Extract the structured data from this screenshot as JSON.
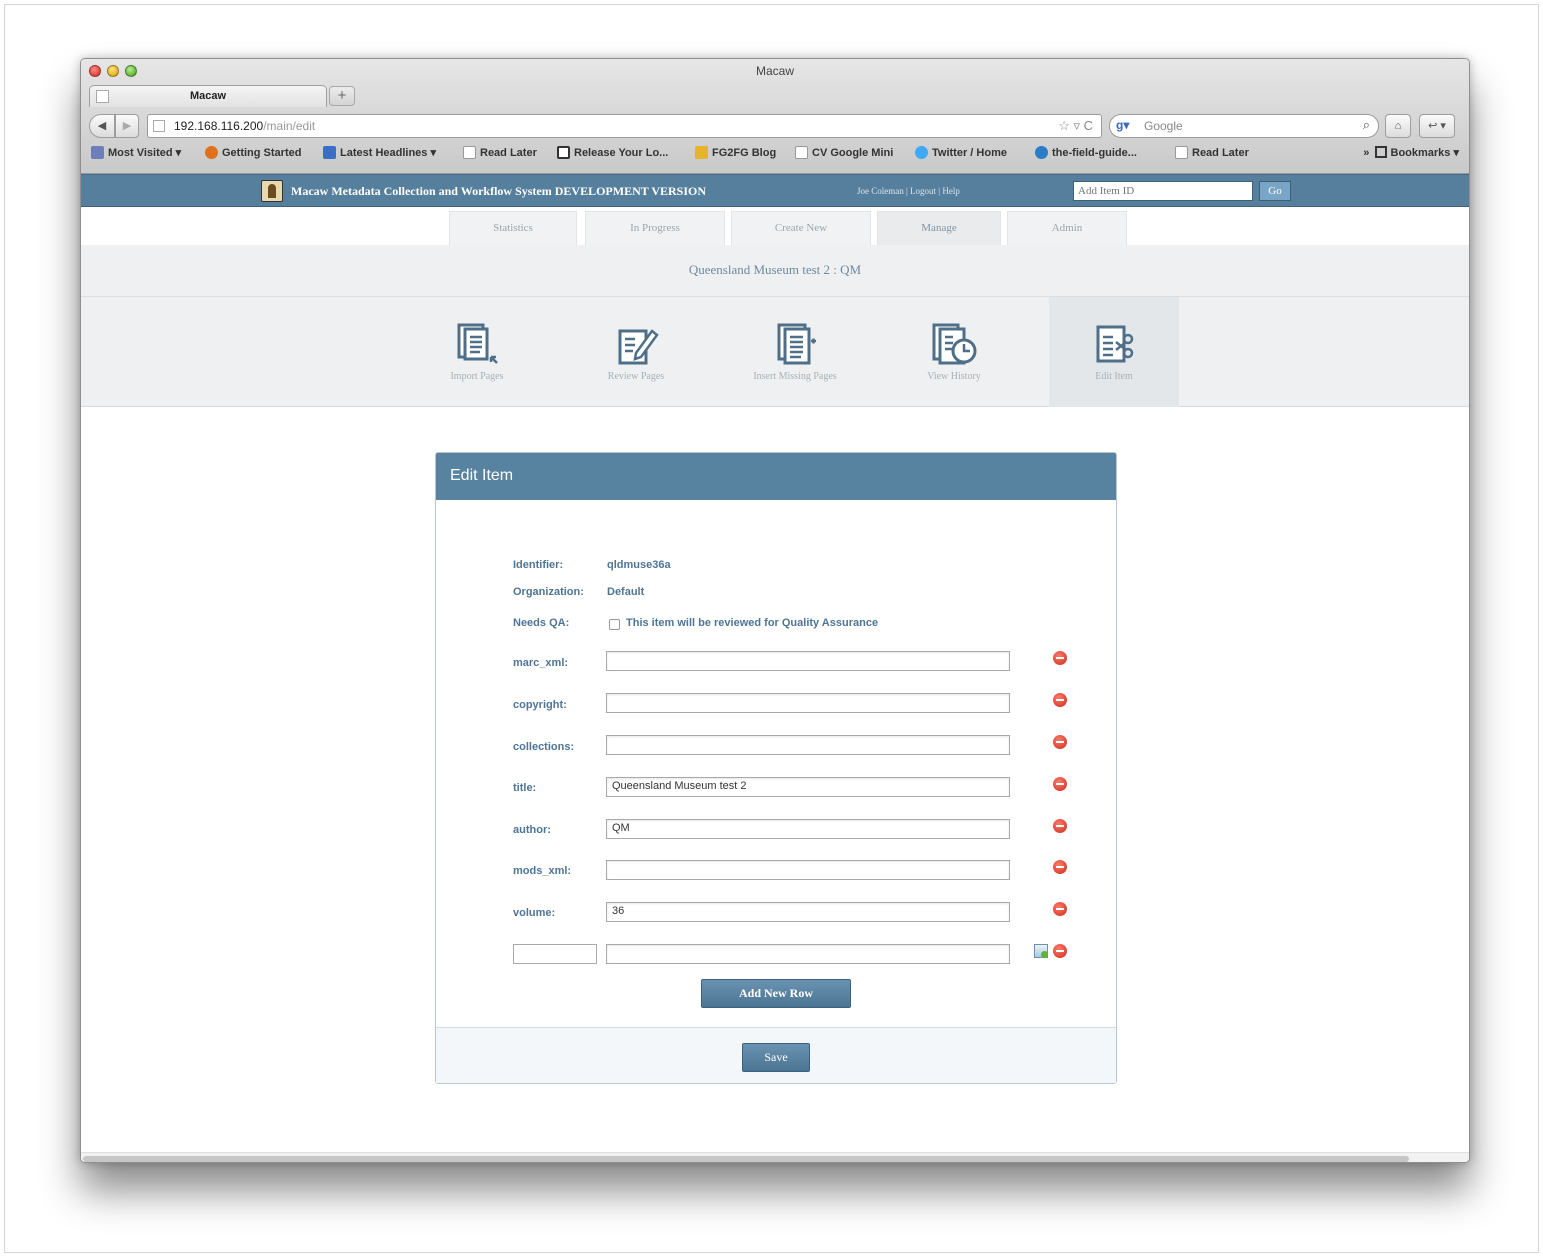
{
  "browser": {
    "window_title": "Macaw",
    "tab_label": "Macaw",
    "new_tab": "+",
    "back": "◀",
    "forward": "▶",
    "url_host": "192.168.116.200",
    "url_path": "/main/edit",
    "url_icons": "☆ ▿ C",
    "search_engine": "g▾",
    "search_placeholder": "Google",
    "search_icon": "⌕",
    "home_icon": "⌂",
    "tools_icon": "↩ ▾",
    "bookmarks": [
      {
        "label": "Most Visited ▾",
        "color": "#6c7fb8"
      },
      {
        "label": "Getting Started",
        "color": "#e0711c"
      },
      {
        "label": "Latest Headlines ▾",
        "color": "#3a6fc8"
      },
      {
        "label": "Read Later",
        "color": "#ffffff"
      },
      {
        "label": "Release Your Lo...",
        "color": "#ffffff"
      },
      {
        "label": "FG2FG Blog",
        "color": "#e6b32b"
      },
      {
        "label": "CV Google Mini",
        "color": "#ffffff"
      },
      {
        "label": "Twitter / Home",
        "color": "#3fa9f5"
      },
      {
        "label": "the-field-guide...",
        "color": "#2b7cc7"
      },
      {
        "label": "Read Later",
        "color": "#ffffff"
      }
    ],
    "bookmarks_overflow": "»",
    "bookmarks_menu": "Bookmarks ▾"
  },
  "app": {
    "title": "Macaw Metadata Collection and Workflow System DEVELOPMENT VERSION",
    "user_links": "Joe Coleman | Logout | Help",
    "item_id_placeholder": "Add Item ID",
    "go_label": "Go"
  },
  "main_tabs": [
    {
      "label": "Statistics",
      "active": false
    },
    {
      "label": "In Progress",
      "active": false
    },
    {
      "label": "Create New",
      "active": false
    },
    {
      "label": "Manage",
      "active": true
    },
    {
      "label": "Admin",
      "active": false
    }
  ],
  "item_title": "Queensland Museum test 2 : QM",
  "tools": [
    {
      "label": "Import Pages",
      "icon": "import-pages-icon",
      "active": false
    },
    {
      "label": "Review Pages",
      "icon": "review-pages-icon",
      "active": false
    },
    {
      "label": "Insert Missing Pages",
      "icon": "insert-missing-pages-icon",
      "active": false
    },
    {
      "label": "View History",
      "icon": "view-history-icon",
      "active": false
    },
    {
      "label": "Edit Item",
      "icon": "edit-item-icon",
      "active": true
    }
  ],
  "panel": {
    "title": "Edit Item",
    "identifier_label": "Identifier:",
    "identifier_value": "qldmuse36a",
    "organization_label": "Organization:",
    "organization_value": "Default",
    "needs_qa_label": "Needs QA:",
    "needs_qa_text": "This item will be reviewed for Quality Assurance",
    "needs_qa_checked": false,
    "fields": [
      {
        "label": "marc_xml:",
        "value": ""
      },
      {
        "label": "copyright:",
        "value": ""
      },
      {
        "label": "collections:",
        "value": ""
      },
      {
        "label": "title:",
        "value": "Queensland Museum test 2"
      },
      {
        "label": "author:",
        "value": "QM"
      },
      {
        "label": "mods_xml:",
        "value": ""
      },
      {
        "label": "volume:",
        "value": "36"
      }
    ],
    "new_row": {
      "key": "",
      "value": ""
    },
    "add_row_label": "Add New Row",
    "save_label": "Save"
  },
  "colors": {
    "header": "#557f9d",
    "panel_header": "#5782a0",
    "label_text": "#4e7596",
    "remove_icon": "#cc2a1c"
  }
}
